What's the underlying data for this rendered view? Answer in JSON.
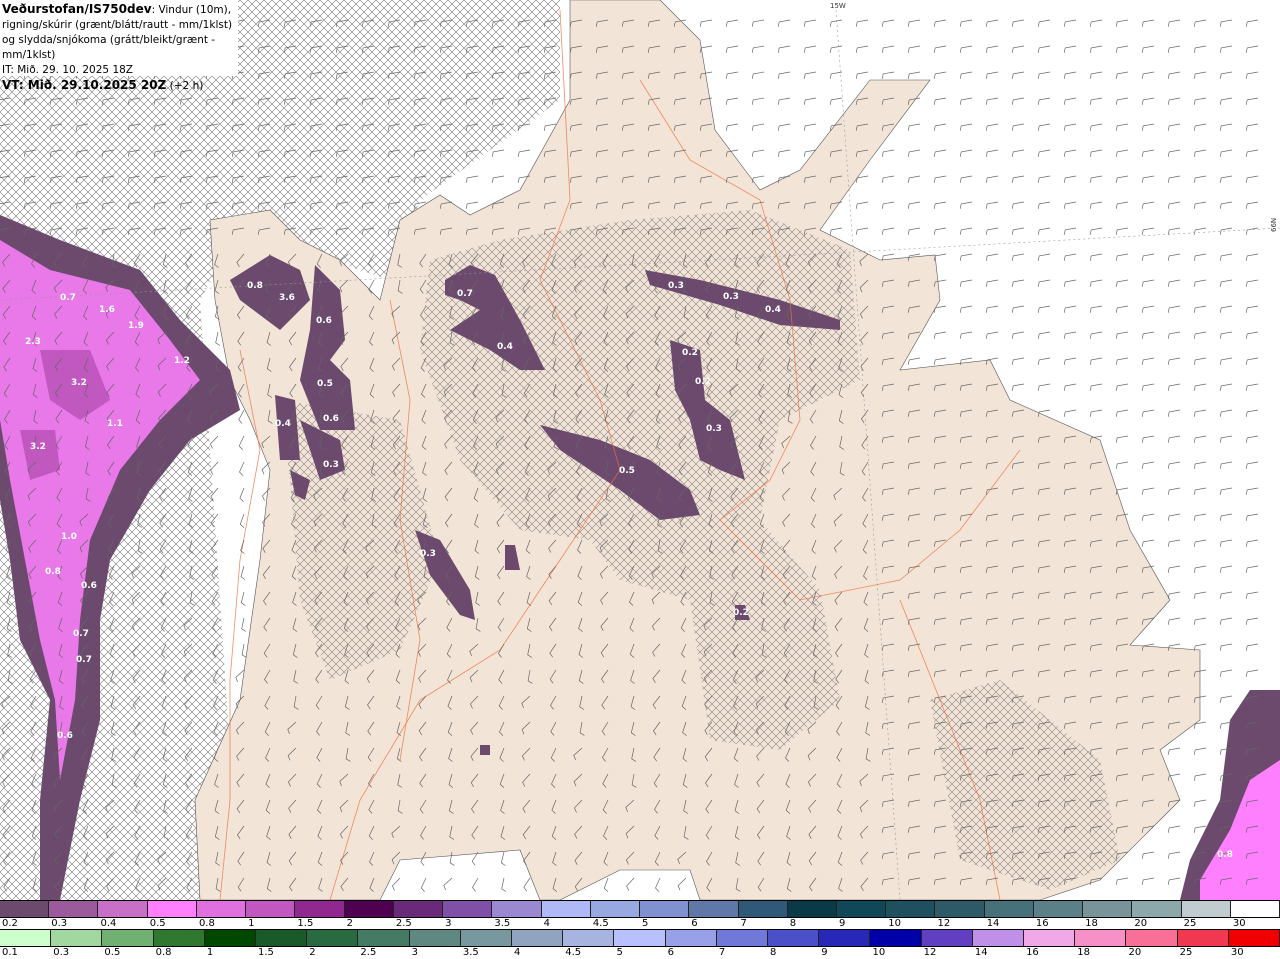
{
  "header": {
    "source": "Veðurstofan/IS750dev",
    "description": ": Vindur (10m), rigning/skúrir (grænt/blátt/rautt - mm/1klst) og slydda/snjókoma (grátt/bleikt/grænt - mm/1klst)",
    "issue_time": "IT: Mið. 29. 10. 2025 18Z",
    "valid_label": "VT: Mið. 29.10.2025 20Z",
    "lead": " (+2 h)"
  },
  "grid_labels": {
    "lon": "15W",
    "lat": "66N"
  },
  "precip_labels": [
    "0.7",
    "1.6",
    "1.9",
    "2.3",
    "3.2",
    "1.2",
    "1.1",
    "3.2",
    "1.0",
    "0.8",
    "0.6",
    "0.7",
    "0.7",
    "0.6",
    "0.8",
    "3.6",
    "0.6",
    "0.5",
    "0.6",
    "0.4",
    "0.3",
    "0.7",
    "0.4",
    "0.3",
    "0.3",
    "0.4",
    "0.2",
    "0.2",
    "0.3",
    "0.5",
    "0.3",
    "0.2",
    "0.8"
  ],
  "colors": {
    "land": "#f2e4d6",
    "sea": "#ffffff",
    "roads": "#f07040",
    "precip_light": "#6b4a6e",
    "precip_heavy": "#ff80ff"
  },
  "legend_snow": {
    "labels": [
      "0.2",
      "0.3",
      "0.4",
      "0.5",
      "0.8",
      "1",
      "1.5",
      "2",
      "2.5",
      "3",
      "3.5",
      "4",
      "4.5",
      "5",
      "6",
      "7",
      "8",
      "9",
      "10",
      "12",
      "14",
      "16",
      "18",
      "20",
      "25",
      "30"
    ],
    "colors": [
      "#6b4a6e",
      "#9a5a9c",
      "#c870c8",
      "#ff80ff",
      "#e070e0",
      "#c058c0",
      "#902890",
      "#500050",
      "#6a2a7a",
      "#8050a8",
      "#9a88d0",
      "#b0b8f8",
      "#98a8e0",
      "#8090d0",
      "#6078a8",
      "#305878",
      "#0a3a48",
      "#104858",
      "#1e5060",
      "#2e5a68",
      "#46707a",
      "#5c8088",
      "#78949a",
      "#8ca8aa",
      "#c0ccd0",
      "#ffffff"
    ]
  },
  "legend_rain": {
    "labels": [
      "0.1",
      "0.3",
      "0.5",
      "0.8",
      "1",
      "1.5",
      "2",
      "2.5",
      "3",
      "3.5",
      "4",
      "4.5",
      "5",
      "6",
      "7",
      "8",
      "9",
      "10",
      "12",
      "14",
      "16",
      "18",
      "20",
      "25",
      "30"
    ],
    "colors": [
      "#ccffcc",
      "#a0d8a0",
      "#70b070",
      "#307830",
      "#004800",
      "#1a5a28",
      "#2a6a40",
      "#457a65",
      "#5e8880",
      "#7898a0",
      "#90a4c0",
      "#a8b4e0",
      "#b8c0ff",
      "#98a0e8",
      "#7078d8",
      "#4a50c8",
      "#2828b8",
      "#0000a8",
      "#6040c0",
      "#c090e8",
      "#f0a8e8",
      "#f890c8",
      "#f87098",
      "#f03850",
      "#f00000"
    ]
  }
}
